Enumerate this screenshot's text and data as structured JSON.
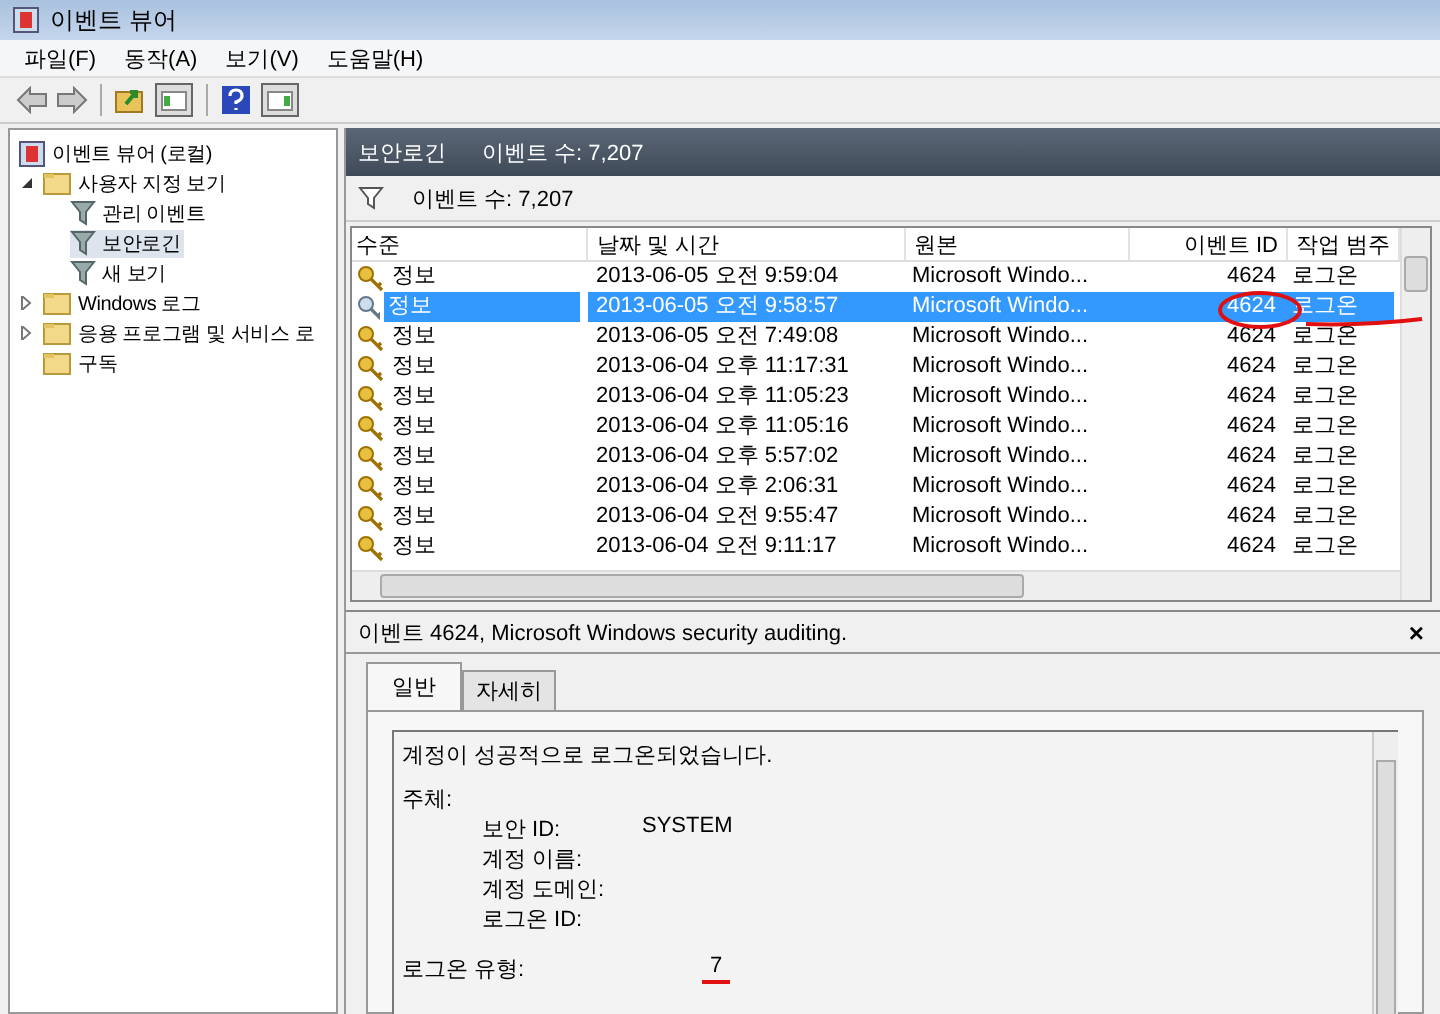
{
  "window": {
    "title": "이벤트 뷰어"
  },
  "menu": [
    "파일(F)",
    "동작(A)",
    "보기(V)",
    "도움말(H)"
  ],
  "tree": [
    {
      "label": "이벤트 뷰어 (로컬)",
      "selected": false,
      "children": [
        {
          "label": "사용자 지정 보기",
          "expanded": true,
          "selected": false,
          "children": [
            {
              "label": "관리 이벤트",
              "selected": false
            },
            {
              "label": "보안로긴",
              "selected": true
            },
            {
              "label": "새 보기",
              "selected": false
            }
          ]
        },
        {
          "label": "Windows 로그",
          "expanded": false,
          "selected": false
        },
        {
          "label": "응용 프로그램 및 서비스 로",
          "expanded": false,
          "selected": false
        },
        {
          "label": "구독",
          "selected": false
        }
      ]
    }
  ],
  "pane": {
    "title": "보안로긴",
    "count": "이벤트 수: 7,207"
  },
  "filter_bar": {
    "count": "이벤트 수: 7,207"
  },
  "table": {
    "columns": [
      "수준",
      "날짜 및 시간",
      "원본",
      "이벤트 ID",
      "작업 범주"
    ],
    "rows": [
      {
        "level": "정보",
        "date": "2013-06-05 오전 9:59:04",
        "source": "Microsoft Windo...",
        "id": "4624",
        "category": "로그온",
        "selected": false
      },
      {
        "level": "정보",
        "date": "2013-06-05 오전 9:58:57",
        "source": "Microsoft Windo...",
        "id": "4624",
        "category": "로그온",
        "selected": true
      },
      {
        "level": "정보",
        "date": "2013-06-05 오전 7:49:08",
        "source": "Microsoft Windo...",
        "id": "4624",
        "category": "로그온",
        "selected": false
      },
      {
        "level": "정보",
        "date": "2013-06-04 오후 11:17:31",
        "source": "Microsoft Windo...",
        "id": "4624",
        "category": "로그온",
        "selected": false
      },
      {
        "level": "정보",
        "date": "2013-06-04 오후 11:05:23",
        "source": "Microsoft Windo...",
        "id": "4624",
        "category": "로그온",
        "selected": false
      },
      {
        "level": "정보",
        "date": "2013-06-04 오후 11:05:16",
        "source": "Microsoft Windo...",
        "id": "4624",
        "category": "로그온",
        "selected": false
      },
      {
        "level": "정보",
        "date": "2013-06-04 오후 5:57:02",
        "source": "Microsoft Windo...",
        "id": "4624",
        "category": "로그온",
        "selected": false
      },
      {
        "level": "정보",
        "date": "2013-06-04 오후 2:06:31",
        "source": "Microsoft Windo...",
        "id": "4624",
        "category": "로그온",
        "selected": false
      },
      {
        "level": "정보",
        "date": "2013-06-04 오전 9:55:47",
        "source": "Microsoft Windo...",
        "id": "4624",
        "category": "로그온",
        "selected": false
      },
      {
        "level": "정보",
        "date": "2013-06-04 오전 9:11:17",
        "source": "Microsoft Windo...",
        "id": "4624",
        "category": "로그온",
        "selected": false
      }
    ]
  },
  "detail": {
    "title": "이벤트 4624, Microsoft Windows security auditing.",
    "close": "×",
    "tabs": [
      {
        "label": "일반",
        "selected": true
      },
      {
        "label": "자세히",
        "selected": false
      }
    ],
    "message": "계정이 성공적으로 로그온되었습니다.",
    "lines": [
      {
        "kind": "heading",
        "label": "주체:"
      },
      {
        "kind": "field",
        "label": "보안 ID:",
        "value": "SYSTEM"
      },
      {
        "kind": "field",
        "label": "계정 이름:"
      },
      {
        "kind": "field",
        "label": "계정 도메인:"
      },
      {
        "kind": "field",
        "label": "로그온 ID:"
      },
      {
        "kind": "top",
        "label": "로그온 유형:",
        "value": "7"
      }
    ]
  }
}
